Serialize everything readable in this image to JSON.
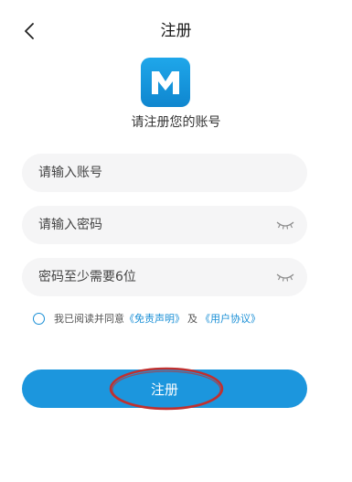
{
  "header": {
    "title": "注册",
    "back_icon": "chevron-left-icon"
  },
  "logo": {
    "letter": "M",
    "color": "#1c96dd"
  },
  "subtitle": "请注册您的账号",
  "form": {
    "account": {
      "placeholder": "请输入账号",
      "value": ""
    },
    "password": {
      "placeholder": "请输入密码",
      "value": "",
      "icon": "eye-closed-icon"
    },
    "confirm_password": {
      "placeholder": "密码至少需要6位",
      "value": "",
      "icon": "eye-closed-icon"
    }
  },
  "agreement": {
    "prefix": "我已阅读并同意",
    "disclaimer_link": "《免责声明》",
    "and": "及",
    "user_agreement_link": "《用户协议》",
    "checked": false
  },
  "submit": {
    "label": "注册",
    "color": "#1c96dd"
  },
  "annotation": {
    "color": "#c0302f"
  }
}
